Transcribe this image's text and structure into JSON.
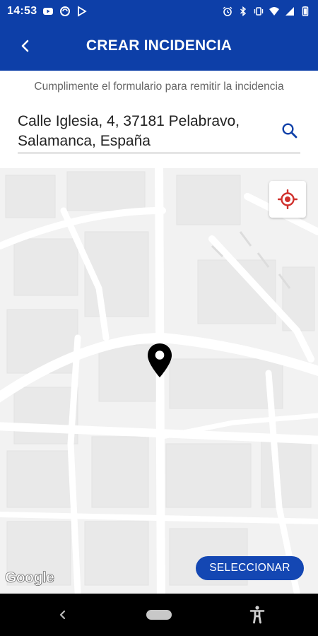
{
  "status_bar": {
    "time": "14:53",
    "left_icons": [
      "youtube-icon",
      "sync-icon",
      "play-store-icon"
    ],
    "right_icons": [
      "alarm-icon",
      "bluetooth-icon",
      "vibrate-icon",
      "wifi-icon",
      "signal-icon",
      "battery-icon"
    ]
  },
  "app_bar": {
    "title": "CREAR INCIDENCIA",
    "back_icon": "chevron-left-icon"
  },
  "form": {
    "instruction": "Cumplimente el formulario para remitir la incidencia",
    "address_line1": "Calle Iglesia, 4, 37181 Pelabravo,",
    "address_line2": "Salamanca, España",
    "search_icon": "search-icon"
  },
  "map": {
    "provider_label": "Google",
    "location_button_icon": "gps-target-icon",
    "marker_icon": "map-pin-icon",
    "select_button_label": "SELECCIONAR"
  },
  "colors": {
    "brand_blue": "#0d3fa8",
    "button_blue": "#1447b3",
    "gps_red": "#d0312d"
  },
  "nav_bar": {
    "icons": [
      "back-icon",
      "home-icon",
      "accessibility-icon"
    ]
  }
}
